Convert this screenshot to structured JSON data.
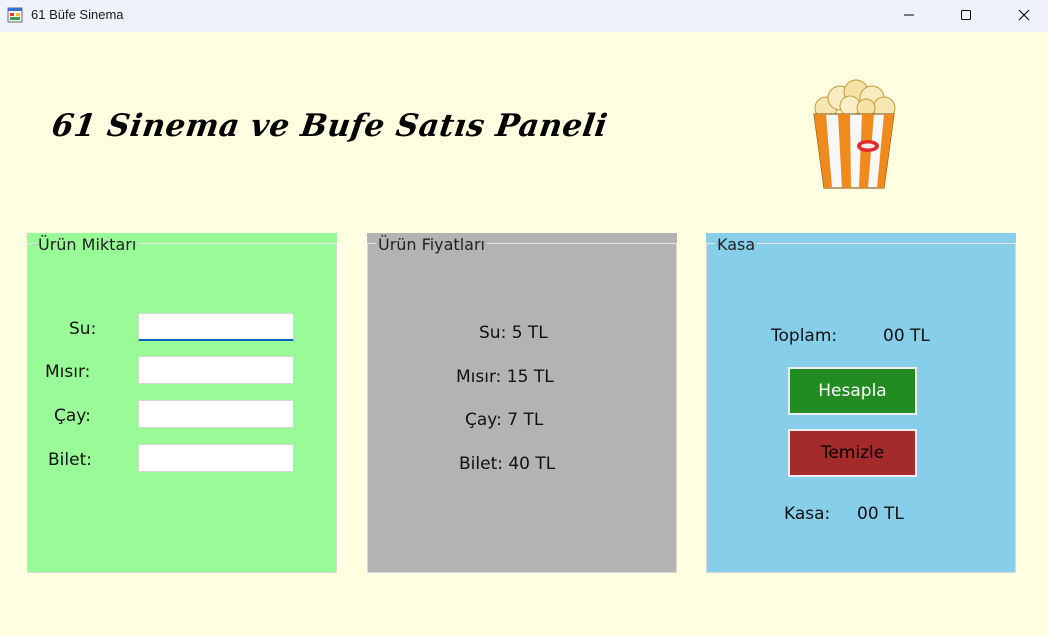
{
  "window": {
    "title": "61 Büfe Sinema"
  },
  "header": {
    "title": "61 Sinema ve Bufe Satıs Paneli"
  },
  "groups": {
    "miktar": {
      "title": "Ürün Miktarı",
      "fields": [
        {
          "label": "Su:",
          "value": ""
        },
        {
          "label": "Mısır:",
          "value": ""
        },
        {
          "label": "Çay:",
          "value": ""
        },
        {
          "label": "Bilet:",
          "value": ""
        }
      ]
    },
    "fiyat": {
      "title": "Ürün Fiyatları",
      "prices": [
        "Su: 5 TL",
        "Mısır: 15 TL",
        "Çay: 7 TL",
        "Bilet: 40 TL"
      ]
    },
    "kasa": {
      "title": "Kasa",
      "toplam_label": "Toplam:",
      "toplam_value": "00 TL",
      "hesapla_label": "Hesapla",
      "temizle_label": "Temizle",
      "kasa_label": "Kasa:",
      "kasa_value": "00 TL"
    }
  },
  "colors": {
    "background": "#fffee0",
    "miktar_panel": "#98fb98",
    "fiyat_panel": "#b3b3b3",
    "kasa_panel": "#87ceeb",
    "hesapla_button": "#228b22",
    "temizle_button": "#a52a2a"
  },
  "icons": {
    "app": "app-window-icon",
    "logo": "popcorn-icon"
  }
}
